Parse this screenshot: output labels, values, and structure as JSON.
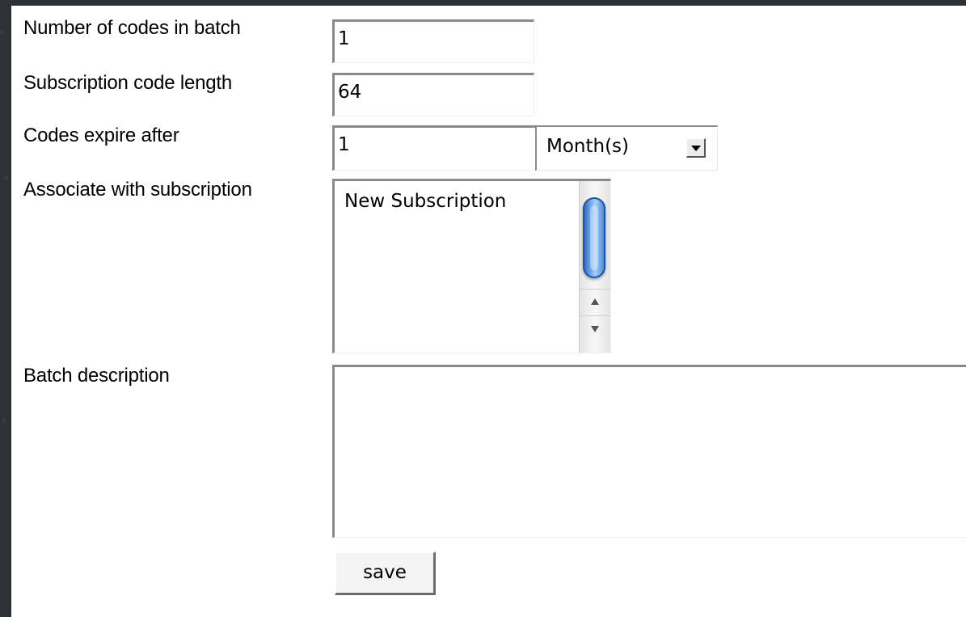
{
  "form": {
    "fields": [
      {
        "label": "Number of codes in batch",
        "value": "1"
      },
      {
        "label": "Subscription code length",
        "value": "64"
      },
      {
        "label": "Codes expire after",
        "value": "1",
        "unit_selected": "Month(s)"
      },
      {
        "label": "Associate with subscription",
        "options": [
          "New Subscription"
        ]
      },
      {
        "label": "Batch description",
        "value": ""
      }
    ],
    "save_label": "save"
  },
  "scroll_thumb": {
    "color": "#3a7fd3"
  }
}
